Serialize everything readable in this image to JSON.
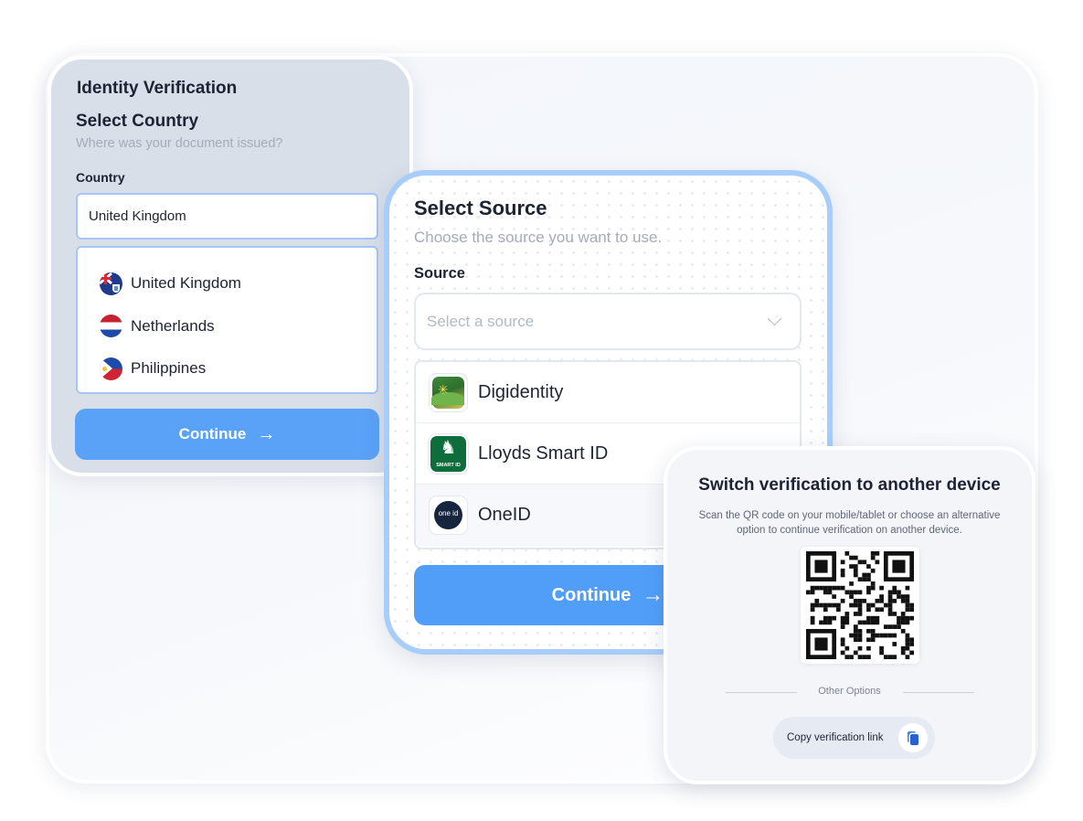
{
  "identity": {
    "app_title": "Identity Verification",
    "section_title": "Select Country",
    "section_subtitle": "Where was your document issued?",
    "field_label": "Country",
    "field_value": "United Kingdom",
    "countries": [
      {
        "label": "United Kingdom",
        "icon": "uk-flag-icon"
      },
      {
        "label": "Netherlands",
        "icon": "netherlands-flag-icon"
      },
      {
        "label": "Philippines",
        "icon": "philippines-flag-icon"
      }
    ],
    "continue_label": "Continue",
    "continue_arrow": "→"
  },
  "source": {
    "title": "Select Source",
    "subtitle": "Choose the source you want to use.",
    "field_label": "Source",
    "select_placeholder": "Select a source",
    "options": [
      {
        "label": "Digidentity",
        "icon": "digidentity-logo-icon"
      },
      {
        "label": "Lloyds Smart ID",
        "icon": "lloyds-logo-icon",
        "logo_text": "SMART ID"
      },
      {
        "label": "OneID",
        "icon": "oneid-logo-icon",
        "logo_text": "one id"
      }
    ],
    "continue_label": "Continue",
    "continue_arrow": "→"
  },
  "switch_device": {
    "title": "Switch verification to another device",
    "description": "Scan the QR code on your mobile/tablet or choose an alternative option to continue verification on another device.",
    "other_options_label": "Other Options",
    "copy_link_label": "Copy verification link",
    "copy_icon": "copy-icon"
  },
  "colors": {
    "accent_blue": "#519ef9",
    "card_border_blue": "#a8cdfb",
    "id_card_bg": "#d8dfe9",
    "text_dark": "#1c2333",
    "text_muted": "#a4acb9"
  }
}
